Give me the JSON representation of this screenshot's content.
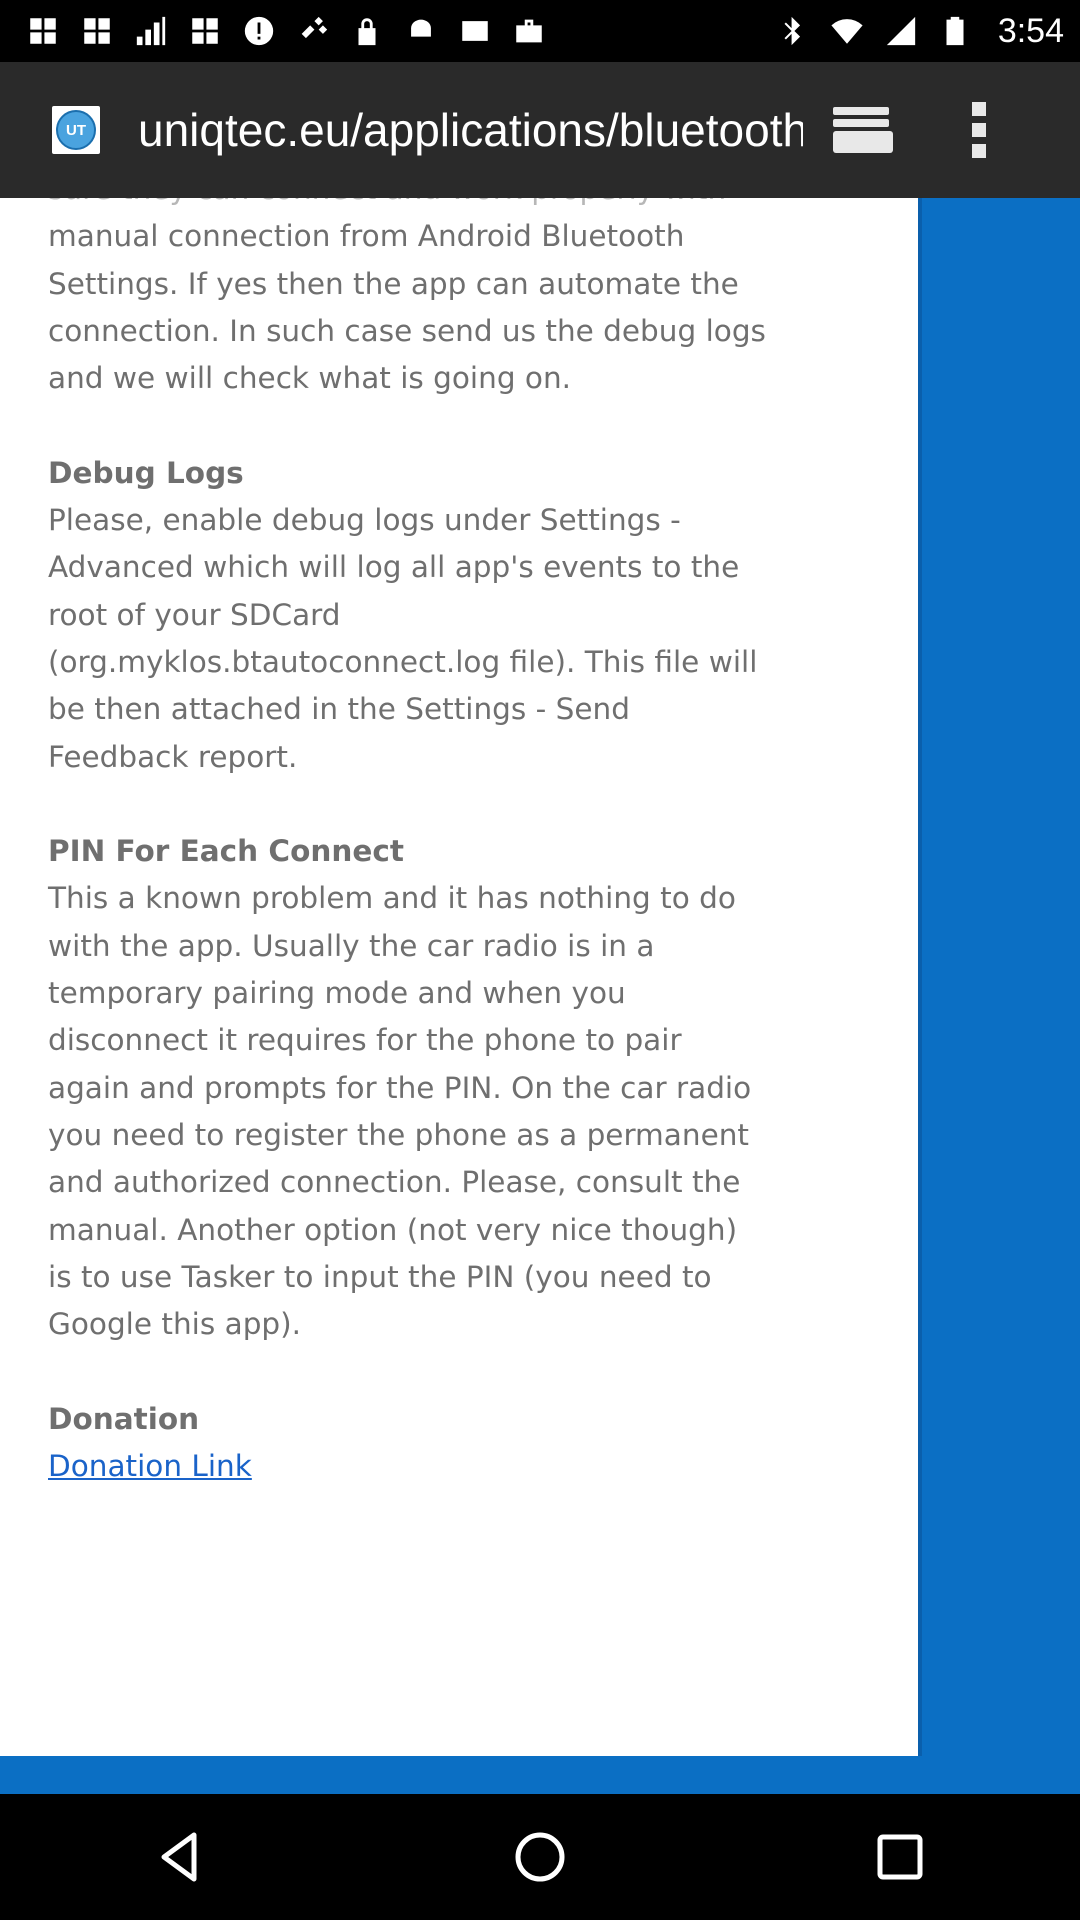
{
  "status_bar": {
    "time": "3:54",
    "left_icons": [
      "grid-icon",
      "grid-icon",
      "signal-icon",
      "grid-icon",
      "alert-icon",
      "satellite-icon",
      "lock-icon",
      "android-icon",
      "inbox-icon",
      "briefcase-icon"
    ],
    "right_icons": [
      "bluetooth-icon",
      "wifi-icon",
      "signal-icon",
      "battery-icon"
    ]
  },
  "browser": {
    "favicon_text": "UT",
    "url": "uniqtec.eu/applications/bluetooth"
  },
  "article": {
    "partial_line": "sure they can connect and work properly with",
    "intro_lines": [
      "manual connection from Android Bluetooth",
      "Settings. If yes then the app can automate the",
      "connection. In such case send us the debug logs",
      "and we will check what is going on."
    ],
    "debug_heading": "Debug Logs",
    "debug_lines": [
      "Please, enable debug logs under Settings -",
      "Advanced which will log all app's events to the",
      "root of your SDCard",
      "(org.myklos.btautoconnect.log file). This file will",
      "be then attached in the Settings - Send",
      "Feedback report."
    ],
    "pin_heading": "PIN For Each Connect",
    "pin_lines": [
      "This a known problem and it has nothing to do",
      "with the app. Usually the car radio is in a",
      "temporary pairing mode and when you",
      "disconnect it requires for the phone to pair",
      "again and prompts for the PIN. On the car radio",
      "you need to register the phone as a permanent",
      "and authorized connection. Please, consult the",
      "manual. Another option (not very nice though)",
      "is to use Tasker to input the PIN (you need to",
      "Google this app)."
    ],
    "donation_heading": "Donation",
    "donation_link": "Donation Link"
  },
  "colors": {
    "page_background": "#0b6fc4",
    "toolbar": "#2a2a2a",
    "link": "#1a63c9",
    "text": "#6f6f6f"
  }
}
